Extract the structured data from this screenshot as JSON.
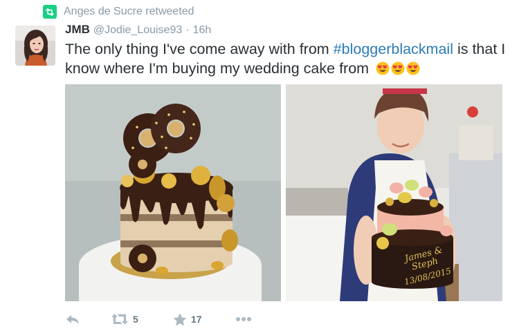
{
  "retweet_context": {
    "text": "Anges de Sucre retweeted",
    "badge_color": "#19cf86",
    "icon": "retweet-icon"
  },
  "tweet": {
    "name": "JMB",
    "handle": "@Jodie_Louise93",
    "separator": "·",
    "time": "16h",
    "text_before": "The only thing I've come away with from ",
    "hashtag": "#bloggerblackmail",
    "text_after": " is that I know where I'm buying my wedding cake from",
    "emoji": [
      "heart-eyes-emoji",
      "heart-eyes-emoji",
      "heart-eyes-emoji"
    ]
  },
  "media": {
    "left_image": "drip-cake-donuts-macarons-photo",
    "right_image": "woman-holding-cake-photo",
    "cake_topper_text": [
      "James &",
      "Steph",
      "13/08/2015"
    ]
  },
  "actions": {
    "reply_icon": "reply-icon",
    "retweet_icon": "retweet-icon",
    "retweet_count": "5",
    "favorite_icon": "star-icon",
    "favorite_count": "17",
    "more_icon": "more-dots-icon"
  },
  "colors": {
    "link": "#2b7bb9",
    "text": "#292f33",
    "muted": "#8899a6",
    "action": "#aab8c2",
    "retweet_green": "#19cf86"
  }
}
